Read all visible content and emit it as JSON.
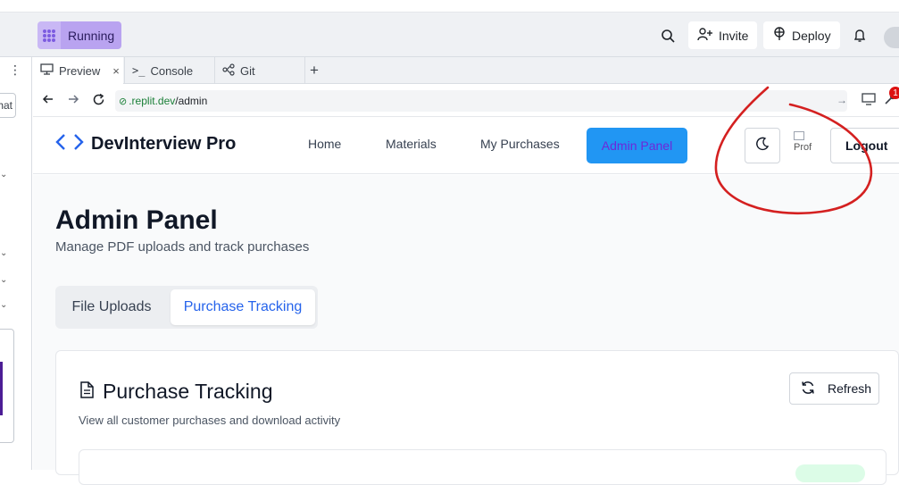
{
  "replit": {
    "run_label": "Running",
    "invite_label": "Invite",
    "deploy_label": "Deploy",
    "notification_count": "1",
    "tabs": [
      {
        "label": "Preview"
      },
      {
        "label": "Console"
      },
      {
        "label": "Git"
      }
    ],
    "url_prefix": ".replit.dev",
    "url_path": "/admin",
    "left_rail_text": "hat"
  },
  "app": {
    "brand": "DevInterview Pro",
    "nav": [
      "Home",
      "Materials",
      "My Purchases"
    ],
    "admin_panel_label": "Admin Panel",
    "avatar_alt": "Prof",
    "logout_label": "Logout",
    "page_title": "Admin Panel",
    "page_subtitle": "Manage PDF uploads and track purchases",
    "segments": [
      "File Uploads",
      "Purchase Tracking"
    ],
    "active_segment": "Purchase Tracking",
    "card_title": "Purchase Tracking",
    "card_subtitle": "View all customer purchases and download activity",
    "refresh_label": "Refresh"
  },
  "colors": {
    "admin_button_bg": "#2196f3",
    "admin_button_text": "#6d28d9",
    "active_segment_text": "#2563eb",
    "annotation": "#d42020"
  }
}
